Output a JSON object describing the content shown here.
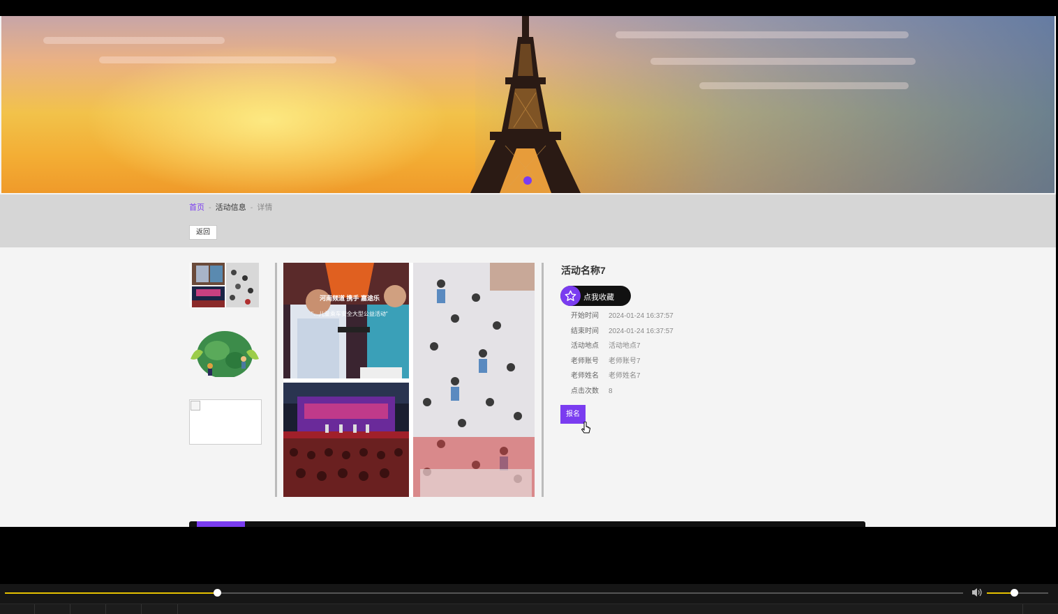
{
  "breadcrumb": {
    "home": "首页",
    "section": "活动信息",
    "current": "详情",
    "sep1": "-",
    "sep2": "-"
  },
  "back_label": "返回",
  "activity": {
    "title": "活动名称7",
    "favorite_label": "点我收藏",
    "fields": [
      {
        "key": "开始时间",
        "value": "2024-01-24 16:37:57"
      },
      {
        "key": "结束时间",
        "value": "2024-01-24 16:37:57"
      },
      {
        "key": "活动地点",
        "value": "活动地点7"
      },
      {
        "key": "老师账号",
        "value": "老师账号7"
      },
      {
        "key": "老师姓名",
        "value": "老师姓名7"
      },
      {
        "key": "点击次数",
        "value": "8"
      }
    ],
    "signup_label": "报名"
  },
  "photo_caption": {
    "line1": "河南频道 携手 嘉途乐",
    "line2": "\"…儿童乘车安全大型公益活动\""
  },
  "colors": {
    "accent": "#7a3cf0",
    "seek": "#e6c200",
    "graybar": "#d6d6d6"
  },
  "player": {
    "progress": 0.22,
    "volume": 0.45
  },
  "icons": [
    "star-icon",
    "volume-icon",
    "broken-image-icon",
    "cursor-icon"
  ]
}
